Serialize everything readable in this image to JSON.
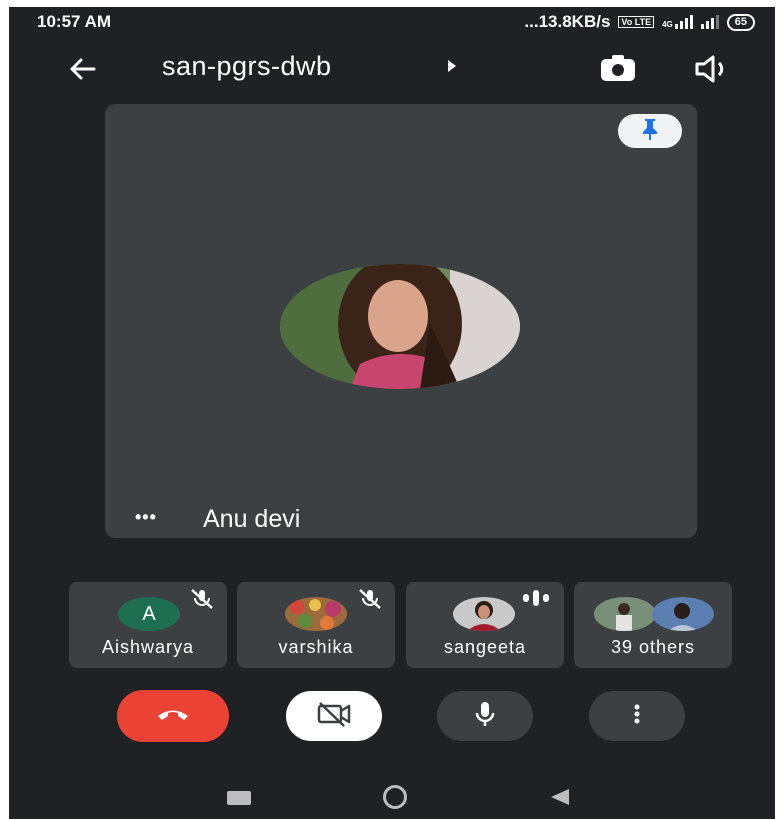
{
  "status_bar": {
    "time": "10:57 AM",
    "network_speed": "...13.8KB/s",
    "volte": "Vo LTE",
    "network_type": "4G",
    "battery": "65"
  },
  "header": {
    "meeting_code": "san-pgrs-dwb"
  },
  "main_tile": {
    "name": "Anu devi",
    "more_dots": "•••"
  },
  "participants": [
    {
      "name": "Aishwarya",
      "initial": "A",
      "muted": true
    },
    {
      "name": "varshika",
      "muted": true
    },
    {
      "name": "sangeeta",
      "speaking": true
    },
    {
      "name": "39 others"
    }
  ],
  "controls": {
    "end_call_color": "#ea4335",
    "camera_off_bg": "#ffffff",
    "ctrl_bg": "#3c4043"
  },
  "colors": {
    "background": "#202124",
    "tile": "#3c4043",
    "accent_blue": "#1a73e8"
  }
}
